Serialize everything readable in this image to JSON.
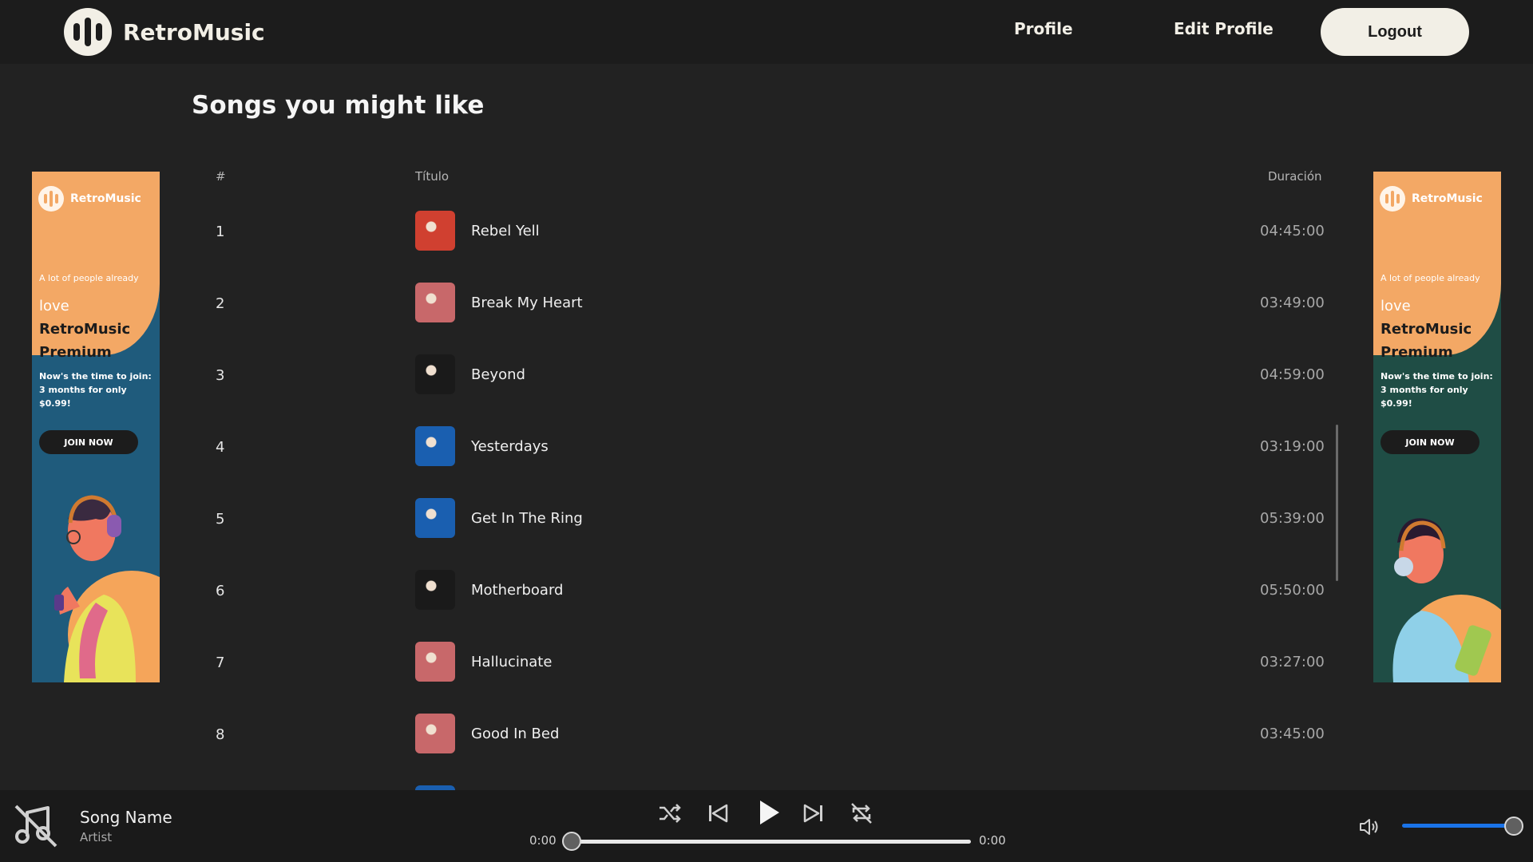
{
  "header": {
    "brand": "RetroMusic",
    "nav": {
      "profile": "Profile",
      "edit_profile": "Edit Profile"
    },
    "logout": "Logout"
  },
  "main": {
    "title": "Songs you might like",
    "columns": {
      "num": "#",
      "title": "Título",
      "duration": "Duración"
    },
    "tracks": [
      {
        "num": "1",
        "title": "Rebel Yell",
        "duration": "04:45:00",
        "cover": "#d04030"
      },
      {
        "num": "2",
        "title": "Break My Heart",
        "duration": "03:49:00",
        "cover": "#c8686a"
      },
      {
        "num": "3",
        "title": "Beyond",
        "duration": "04:59:00",
        "cover": "#1a1a1a"
      },
      {
        "num": "4",
        "title": "Yesterdays",
        "duration": "03:19:00",
        "cover": "#1a5fb0"
      },
      {
        "num": "5",
        "title": "Get In The Ring",
        "duration": "05:39:00",
        "cover": "#1a5fb0"
      },
      {
        "num": "6",
        "title": "Motherboard",
        "duration": "05:50:00",
        "cover": "#1a1a1a"
      },
      {
        "num": "7",
        "title": "Hallucinate",
        "duration": "03:27:00",
        "cover": "#c8686a"
      },
      {
        "num": "8",
        "title": "Good In Bed",
        "duration": "03:45:00",
        "cover": "#c8686a"
      },
      {
        "num": "",
        "title": "",
        "duration": "",
        "cover": "#1a5fb0"
      }
    ]
  },
  "ads": {
    "brand": "RetroMusic",
    "tagline_small": "A lot of people already",
    "tagline_love": "love",
    "tagline_big": "RetroMusic Premium",
    "offer": "Now's the time to join: 3 months for only $0.99!",
    "button": "JOIN NOW"
  },
  "player": {
    "song_name": "Song Name",
    "artist": "Artist",
    "time_current": "0:00",
    "time_total": "0:00",
    "progress_fraction": 0,
    "volume_fraction": 1
  },
  "colors": {
    "background": "#222222",
    "header": "#1c1c1c",
    "accent_cream": "#f2efe6",
    "volume_blue": "#1a73e8",
    "ad_orange": "#f3a865"
  }
}
